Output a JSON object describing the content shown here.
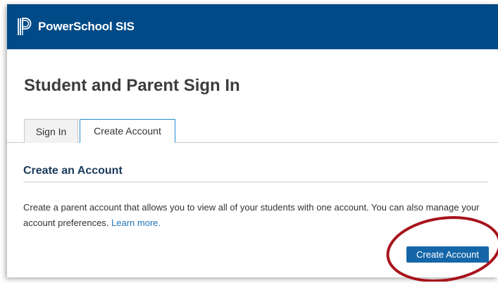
{
  "header": {
    "app_title": "PowerSchool SIS",
    "logo_icon": "powerschool-logo-icon",
    "background_color": "#004a87"
  },
  "page": {
    "title": "Student and Parent Sign In"
  },
  "tabs": [
    {
      "label": "Sign In",
      "active": false
    },
    {
      "label": "Create Account",
      "active": true
    }
  ],
  "section": {
    "title": "Create an Account",
    "description_text": "Create a parent account that allows you to view all of your students with one account. You can also manage your account preferences.",
    "learn_more_link": "Learn more."
  },
  "actions": {
    "create_account_button": "Create Account",
    "button_color": "#1566a8"
  },
  "annotation": {
    "highlight_color": "#a8141c"
  }
}
